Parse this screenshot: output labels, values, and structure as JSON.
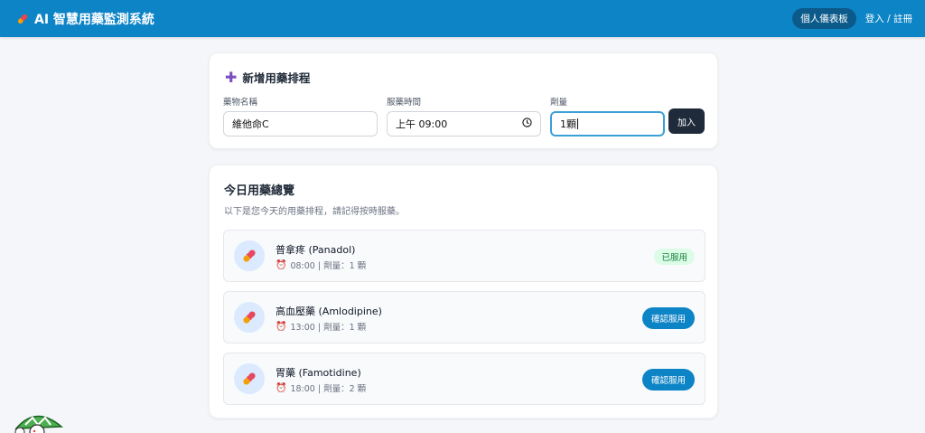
{
  "app": {
    "title": "AI 智慧用藥監測系統"
  },
  "nav": {
    "dashboard_label": "個人儀表板",
    "login_label": "登入 / 註冊"
  },
  "add_form": {
    "title": "新增用藥排程",
    "name_label": "藥物名稱",
    "name_value": "維他命C",
    "time_label": "服藥時間",
    "time_value": "上午 09:00",
    "dose_label": "劑量",
    "dose_value": "1顆",
    "submit_label": "加入"
  },
  "today": {
    "title": "今日用藥總覽",
    "subtitle": "以下是您今天的用藥排程，請記得按時服藥。",
    "items": [
      {
        "name": "普拿疼 (Panadol)",
        "meta": "08:00 | 劑量：1 顆",
        "status": "taken",
        "status_label": "已服用"
      },
      {
        "name": "高血壓藥 (Amlodipine)",
        "meta": "13:00 | 劑量：1 顆",
        "status": "pending",
        "status_label": "確認服用"
      },
      {
        "name": "胃藥 (Famotidine)",
        "meta": "18:00 | 劑量：2 顆",
        "status": "pending",
        "status_label": "確認服用"
      }
    ]
  },
  "colors": {
    "nav_bg": "#0d84c6",
    "accent": "#0d84c6",
    "dark_button": "#1f2a3a",
    "taken_bg": "#dcfce7",
    "taken_text": "#15803d"
  },
  "icons": {
    "brand": "pill-icon",
    "add": "plus-icon",
    "time": "clock-icon",
    "item": "pill-icon",
    "meta": "alarm-clock-icon"
  }
}
